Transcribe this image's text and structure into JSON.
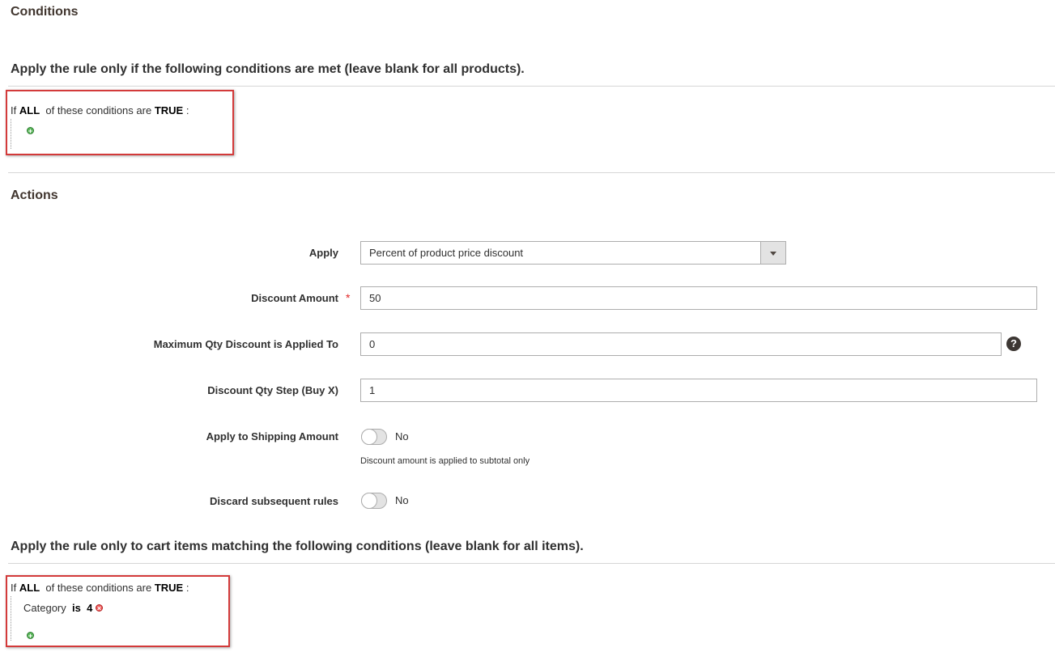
{
  "conditions": {
    "title": "Conditions",
    "description": "Apply the rule only if the following conditions are met (leave blank for all products).",
    "rule": {
      "if_text": "If",
      "aggregator": "ALL",
      "middle_text": "of these conditions are",
      "value": "TRUE",
      "suffix": ":"
    }
  },
  "actions": {
    "title": "Actions",
    "fields": {
      "apply": {
        "label": "Apply",
        "value": "Percent of product price discount"
      },
      "discount_amount": {
        "label": "Discount Amount",
        "required_mark": "*",
        "value": "50"
      },
      "max_qty": {
        "label": "Maximum Qty Discount is Applied To",
        "value": "0",
        "help": "?"
      },
      "qty_step": {
        "label": "Discount Qty Step (Buy X)",
        "value": "1"
      },
      "apply_shipping": {
        "label": "Apply to Shipping Amount",
        "state": "No",
        "note": "Discount amount is applied to subtotal only"
      },
      "discard_rules": {
        "label": "Discard subsequent rules",
        "state": "No"
      }
    }
  },
  "item_conditions": {
    "description": "Apply the rule only to cart items matching the following conditions (leave blank for all items).",
    "rule": {
      "if_text": "If",
      "aggregator": "ALL",
      "middle_text": "of these conditions are",
      "value": "TRUE",
      "suffix": ":"
    },
    "condition": {
      "attribute": "Category",
      "operator": "is",
      "value": "4"
    }
  },
  "colors": {
    "highlight_box": "#d33a3a",
    "add_icon": "#5cb85c",
    "remove_icon": "#f25d5d",
    "required": "#e22626"
  }
}
